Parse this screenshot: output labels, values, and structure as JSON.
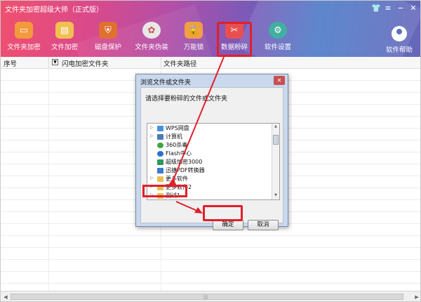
{
  "window": {
    "title": "文件夹加密超级大师（正式版）",
    "controls": [
      "👕",
      "≡",
      "−",
      "✕"
    ]
  },
  "toolbar": {
    "items": [
      {
        "label": "文件夹加密",
        "icon": "folder-lock-icon",
        "color": "#f39a3c"
      },
      {
        "label": "文件加密",
        "icon": "file-lock-icon",
        "color": "#f0c050"
      },
      {
        "label": "磁盘保护",
        "icon": "shield-icon",
        "color": "#e07030"
      },
      {
        "label": "文件夹伪装",
        "icon": "disguise-icon",
        "color": "#e8e8e8"
      },
      {
        "label": "万能锁",
        "icon": "padlock-icon",
        "color": "#f0a040"
      },
      {
        "label": "数据粉碎",
        "icon": "scissors-icon",
        "color": "#e85050"
      },
      {
        "label": "软件设置",
        "icon": "gear-icon",
        "color": "#40b0a0"
      }
    ],
    "help_label": "软件帮助"
  },
  "table": {
    "columns": [
      "序号",
      "闪电加密文件夹",
      "文件夹路径"
    ],
    "checkbox_glyph": "▼"
  },
  "dialog": {
    "title": "浏览文件或文件夹",
    "close_glyph": "✕",
    "prompt": "请选择要粉碎的文件或文件夹",
    "tree": [
      {
        "label": "WPS网盘",
        "icon": "cloud-drive-icon",
        "color": "#4a90d9",
        "expandable": true
      },
      {
        "label": "计算机",
        "icon": "computer-icon",
        "color": "#4a7ab8",
        "expandable": true
      },
      {
        "label": "360杀毒",
        "icon": "antivirus-icon",
        "color": "#3aa844",
        "expandable": false
      },
      {
        "label": "Flash中心",
        "icon": "flash-icon",
        "color": "#2a6fd0",
        "expandable": false
      },
      {
        "label": "超级加密3000",
        "icon": "lock-app-icon",
        "color": "#2a9a60",
        "expandable": false
      },
      {
        "label": "迅捷PDF转换器",
        "icon": "pdf-icon",
        "color": "#3a7ad0",
        "expandable": false
      },
      {
        "label": "更多软件",
        "icon": "folder-icon",
        "color": "#e8c050",
        "expandable": true
      },
      {
        "label": "更多软件2",
        "icon": "folder-icon",
        "color": "#e8c050",
        "expandable": true
      },
      {
        "label": "测试1",
        "icon": "folder-icon",
        "color": "#e8c050",
        "expandable": true
      }
    ],
    "ok_label": "确定",
    "cancel_label": "取消"
  },
  "colors": {
    "highlight": "#e0202a"
  }
}
